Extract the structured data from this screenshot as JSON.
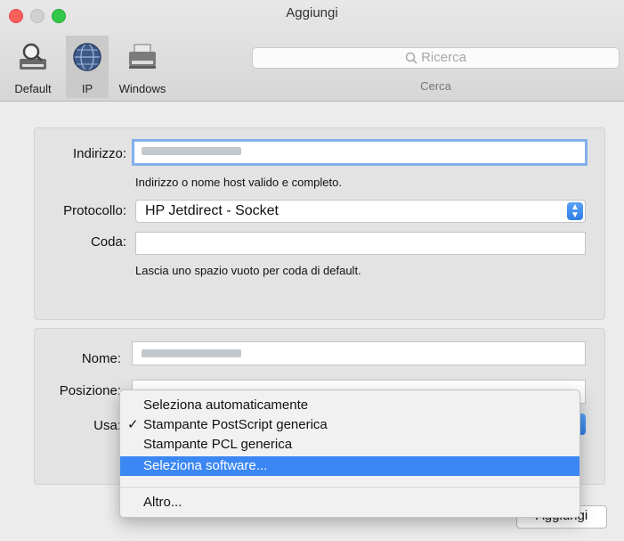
{
  "window": {
    "title": "Aggiungi"
  },
  "toolbar": {
    "items": [
      {
        "label": "Default",
        "icon": "magnifier-printer-icon"
      },
      {
        "label": "IP",
        "icon": "globe-icon",
        "selected": true
      },
      {
        "label": "Windows",
        "icon": "printer-icon"
      }
    ],
    "search": {
      "placeholder": "Ricerca",
      "caption": "Cerca",
      "icon": "search-icon"
    }
  },
  "form": {
    "address": {
      "label": "Indirizzo:",
      "value": "",
      "hint": "Indirizzo o nome host valido e completo."
    },
    "protocol": {
      "label": "Protocollo:",
      "value": "HP Jetdirect - Socket"
    },
    "queue": {
      "label": "Coda:",
      "value": "",
      "hint": "Lascia uno spazio vuoto per coda di default."
    },
    "name": {
      "label": "Nome:",
      "value": ""
    },
    "location": {
      "label": "Posizione:"
    },
    "use": {
      "label": "Usa:"
    }
  },
  "menu": {
    "items": [
      {
        "label": "Seleziona automaticamente"
      },
      {
        "label": "Stampante PostScript generica",
        "checked": true
      },
      {
        "label": "Stampante PCL generica"
      },
      {
        "label": "Seleziona software...",
        "highlighted": true
      }
    ],
    "other": "Altro..."
  },
  "buttons": {
    "add": "Aggiungi"
  },
  "colors": {
    "accent": "#3b87f3",
    "focus_ring": "#83b0ea",
    "window_bg": "#ececec"
  }
}
